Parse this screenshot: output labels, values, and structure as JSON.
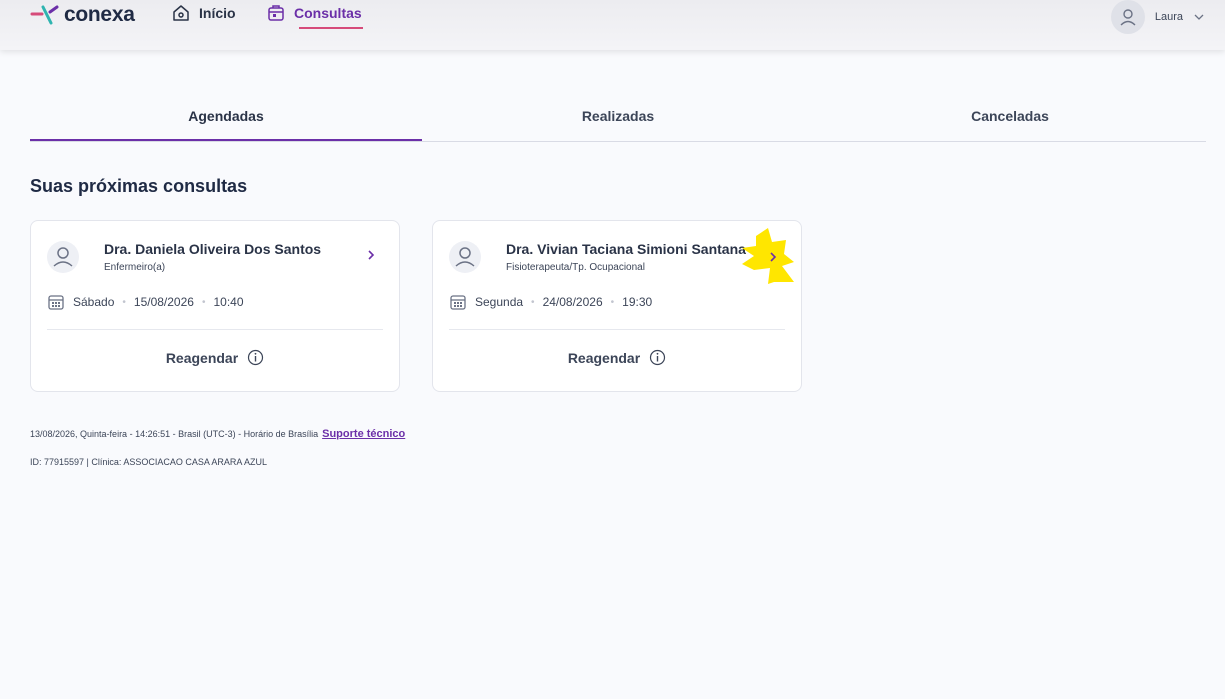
{
  "brand": {
    "name": "conexa"
  },
  "nav": {
    "home_label": "Início",
    "consultas_label": "Consultas"
  },
  "user": {
    "name": "Laura"
  },
  "tabs": [
    {
      "label": "Agendadas",
      "active": true
    },
    {
      "label": "Realizadas",
      "active": false
    },
    {
      "label": "Canceladas",
      "active": false
    }
  ],
  "section_title": "Suas próximas consultas",
  "appointments": [
    {
      "doctor": "Dra. Daniela Oliveira Dos Santos",
      "specialty": "Enfermeiro(a)",
      "weekday": "Sábado",
      "date": "15/08/2026",
      "time": "10:40",
      "action": "Reagendar"
    },
    {
      "doctor": "Dra. Vivian Taciana Simioni Santana",
      "specialty": "Fisioterapeuta/Tp. Ocupacional",
      "weekday": "Segunda",
      "date": "24/08/2026",
      "time": "19:30",
      "action": "Reagendar"
    }
  ],
  "footer": {
    "timestamp_text": "13/08/2026, Quinta-feira - 14:26:51 - Brasil (UTC-3) - Horário de Brasília",
    "support_link": "Suporte técnico",
    "id_text": "ID: 77915597 | Clínica: ASSOCIACAO CASA ARARA AZUL"
  },
  "colors": {
    "accent": "#6b2fa8",
    "nav_underline": "#d64b7a",
    "highlight": "#ffe600"
  }
}
